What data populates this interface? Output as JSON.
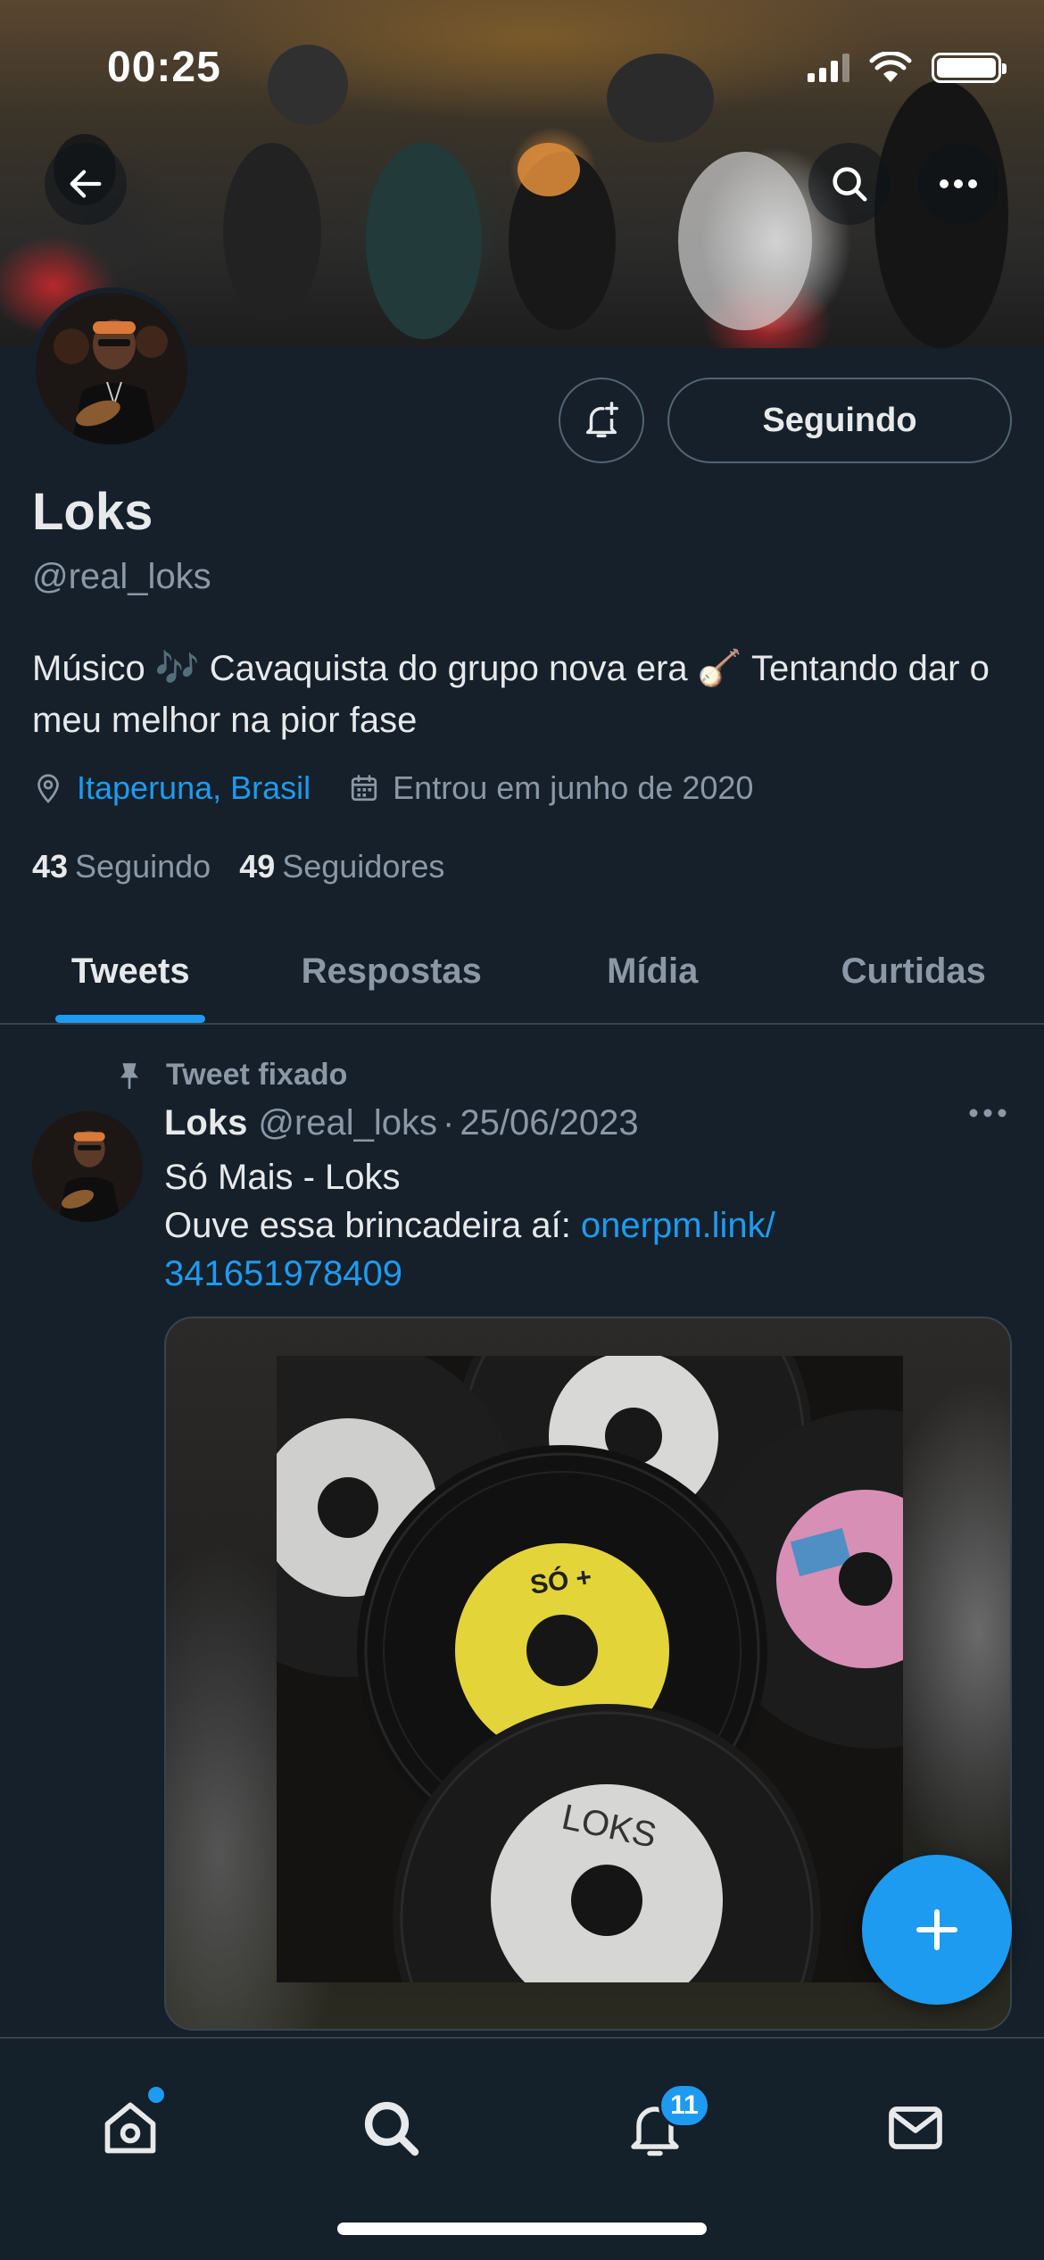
{
  "status_bar": {
    "time": "00:25"
  },
  "profile": {
    "name": "Loks",
    "handle": "@real_loks",
    "bio": "Músico 🎶 Cavaquista do grupo nova era 🪕 Tentando dar o meu melhor na pior fase",
    "location": "Itaperuna, Brasil",
    "joined": "Entrou em junho de 2020",
    "following_count": "43",
    "following_label": "Seguindo",
    "followers_count": "49",
    "followers_label": "Seguidores",
    "follow_button_label": "Seguindo"
  },
  "tabs": [
    {
      "label": "Tweets",
      "active": true
    },
    {
      "label": "Respostas",
      "active": false
    },
    {
      "label": "Mídia",
      "active": false
    },
    {
      "label": "Curtidas",
      "active": false
    }
  ],
  "tweet": {
    "pinned_label": "Tweet fixado",
    "author_name": "Loks",
    "author_handle": "@real_loks",
    "separator": "·",
    "date": "25/06/2023",
    "line1": "Só Mais - Loks",
    "line2_prefix": "Ouve essa brincadeira aí: ",
    "link": "onerpm.link/ 341651978409",
    "record_label_1": "SÓ +",
    "record_label_2": "LOKS"
  },
  "bottom_nav": {
    "notifications_badge": "11"
  },
  "colors": {
    "background": "#15202b",
    "accent": "#1d9bf0",
    "secondary_text": "#8b98a5",
    "border": "#38444d"
  }
}
